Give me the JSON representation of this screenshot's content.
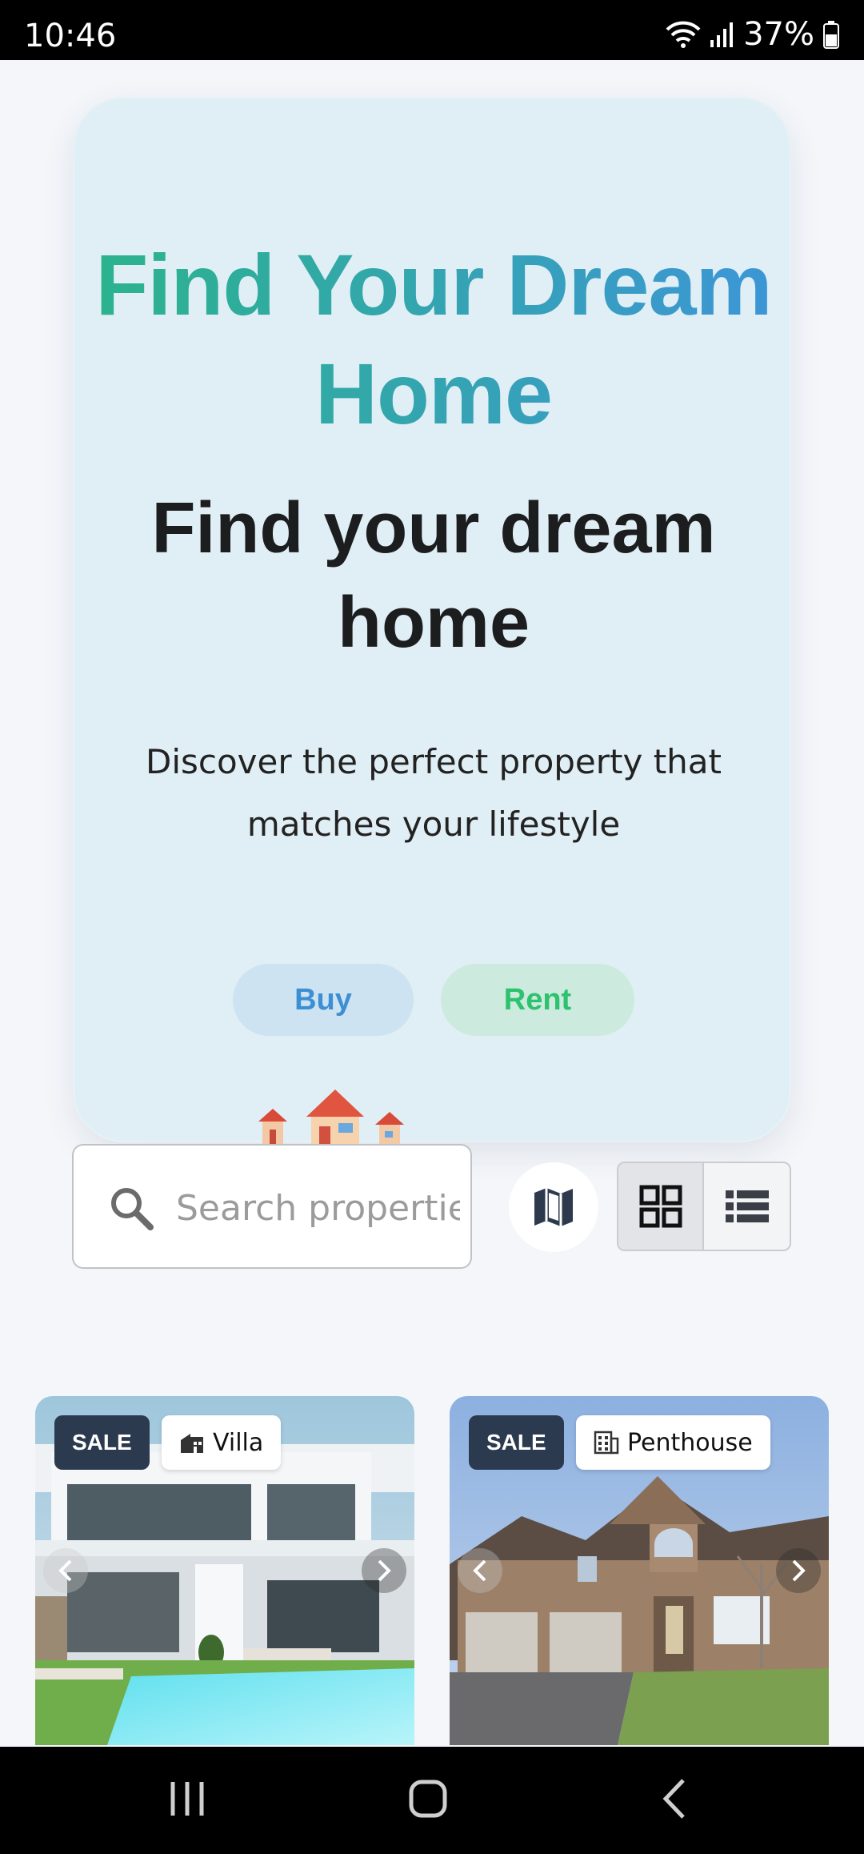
{
  "status_bar": {
    "time": "10:46",
    "battery": "37%"
  },
  "hero": {
    "title": "Find Your Dream Home",
    "subtitle": "Find your dream home",
    "description": "Discover the perfect property that matches your lifestyle",
    "buy_label": "Buy",
    "rent_label": "Rent",
    "title_gradient": [
      "#2bb48a",
      "#3d95d8"
    ]
  },
  "search": {
    "placeholder": "Search properties"
  },
  "view_mode": {
    "selected": "grid"
  },
  "listings": [
    {
      "status": "SALE",
      "type": "Villa",
      "type_icon": "villa-icon"
    },
    {
      "status": "SALE",
      "type": "Penthouse",
      "type_icon": "building-icon"
    }
  ]
}
